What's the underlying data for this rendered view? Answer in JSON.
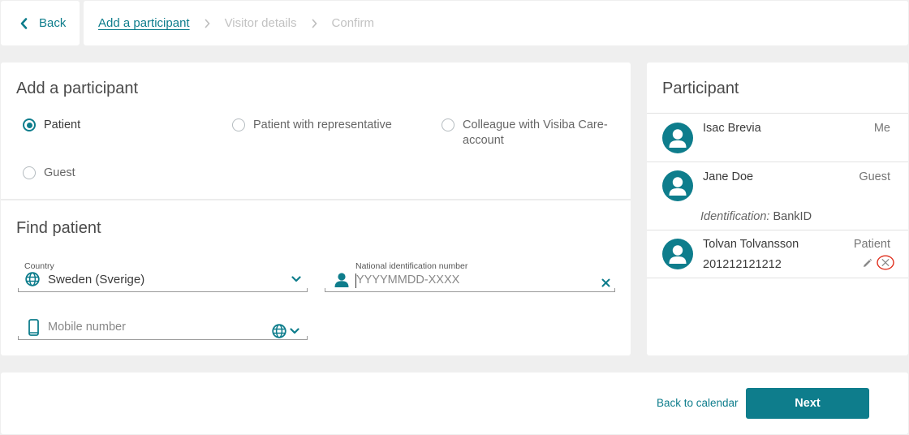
{
  "topbar": {
    "back_label": "Back",
    "breadcrumbs": [
      {
        "label": "Add a participant",
        "active": true
      },
      {
        "label": "Visitor details",
        "active": false
      },
      {
        "label": "Confirm",
        "active": false
      }
    ]
  },
  "add_participant": {
    "title": "Add a participant",
    "options": [
      {
        "label": "Patient",
        "checked": true
      },
      {
        "label": "Patient with representative",
        "checked": false
      },
      {
        "label": "Colleague with Visiba Care-account",
        "checked": false
      },
      {
        "label": "Guest",
        "checked": false
      }
    ]
  },
  "find_patient": {
    "title": "Find patient",
    "country": {
      "label": "Country",
      "value": "Sweden (Sverige)"
    },
    "national_id": {
      "label": "National identification number",
      "placeholder": "YYYYMMDD-XXXX",
      "value": ""
    },
    "mobile": {
      "placeholder": "Mobile number",
      "value": ""
    }
  },
  "participants": {
    "title": "Participant",
    "items": [
      {
        "name": "Isac Brevia",
        "role": "Me"
      },
      {
        "name": "Jane Doe",
        "role": "Guest",
        "identification_label": "Identification:",
        "identification_value": "BankID"
      },
      {
        "name": "Tolvan Tolvansson",
        "role": "Patient",
        "id_number": "201212121212"
      }
    ]
  },
  "footer": {
    "back_to_calendar": "Back to calendar",
    "next": "Next"
  },
  "colors": {
    "accent": "#0e7d8c",
    "remove_highlight": "#e0301e"
  }
}
